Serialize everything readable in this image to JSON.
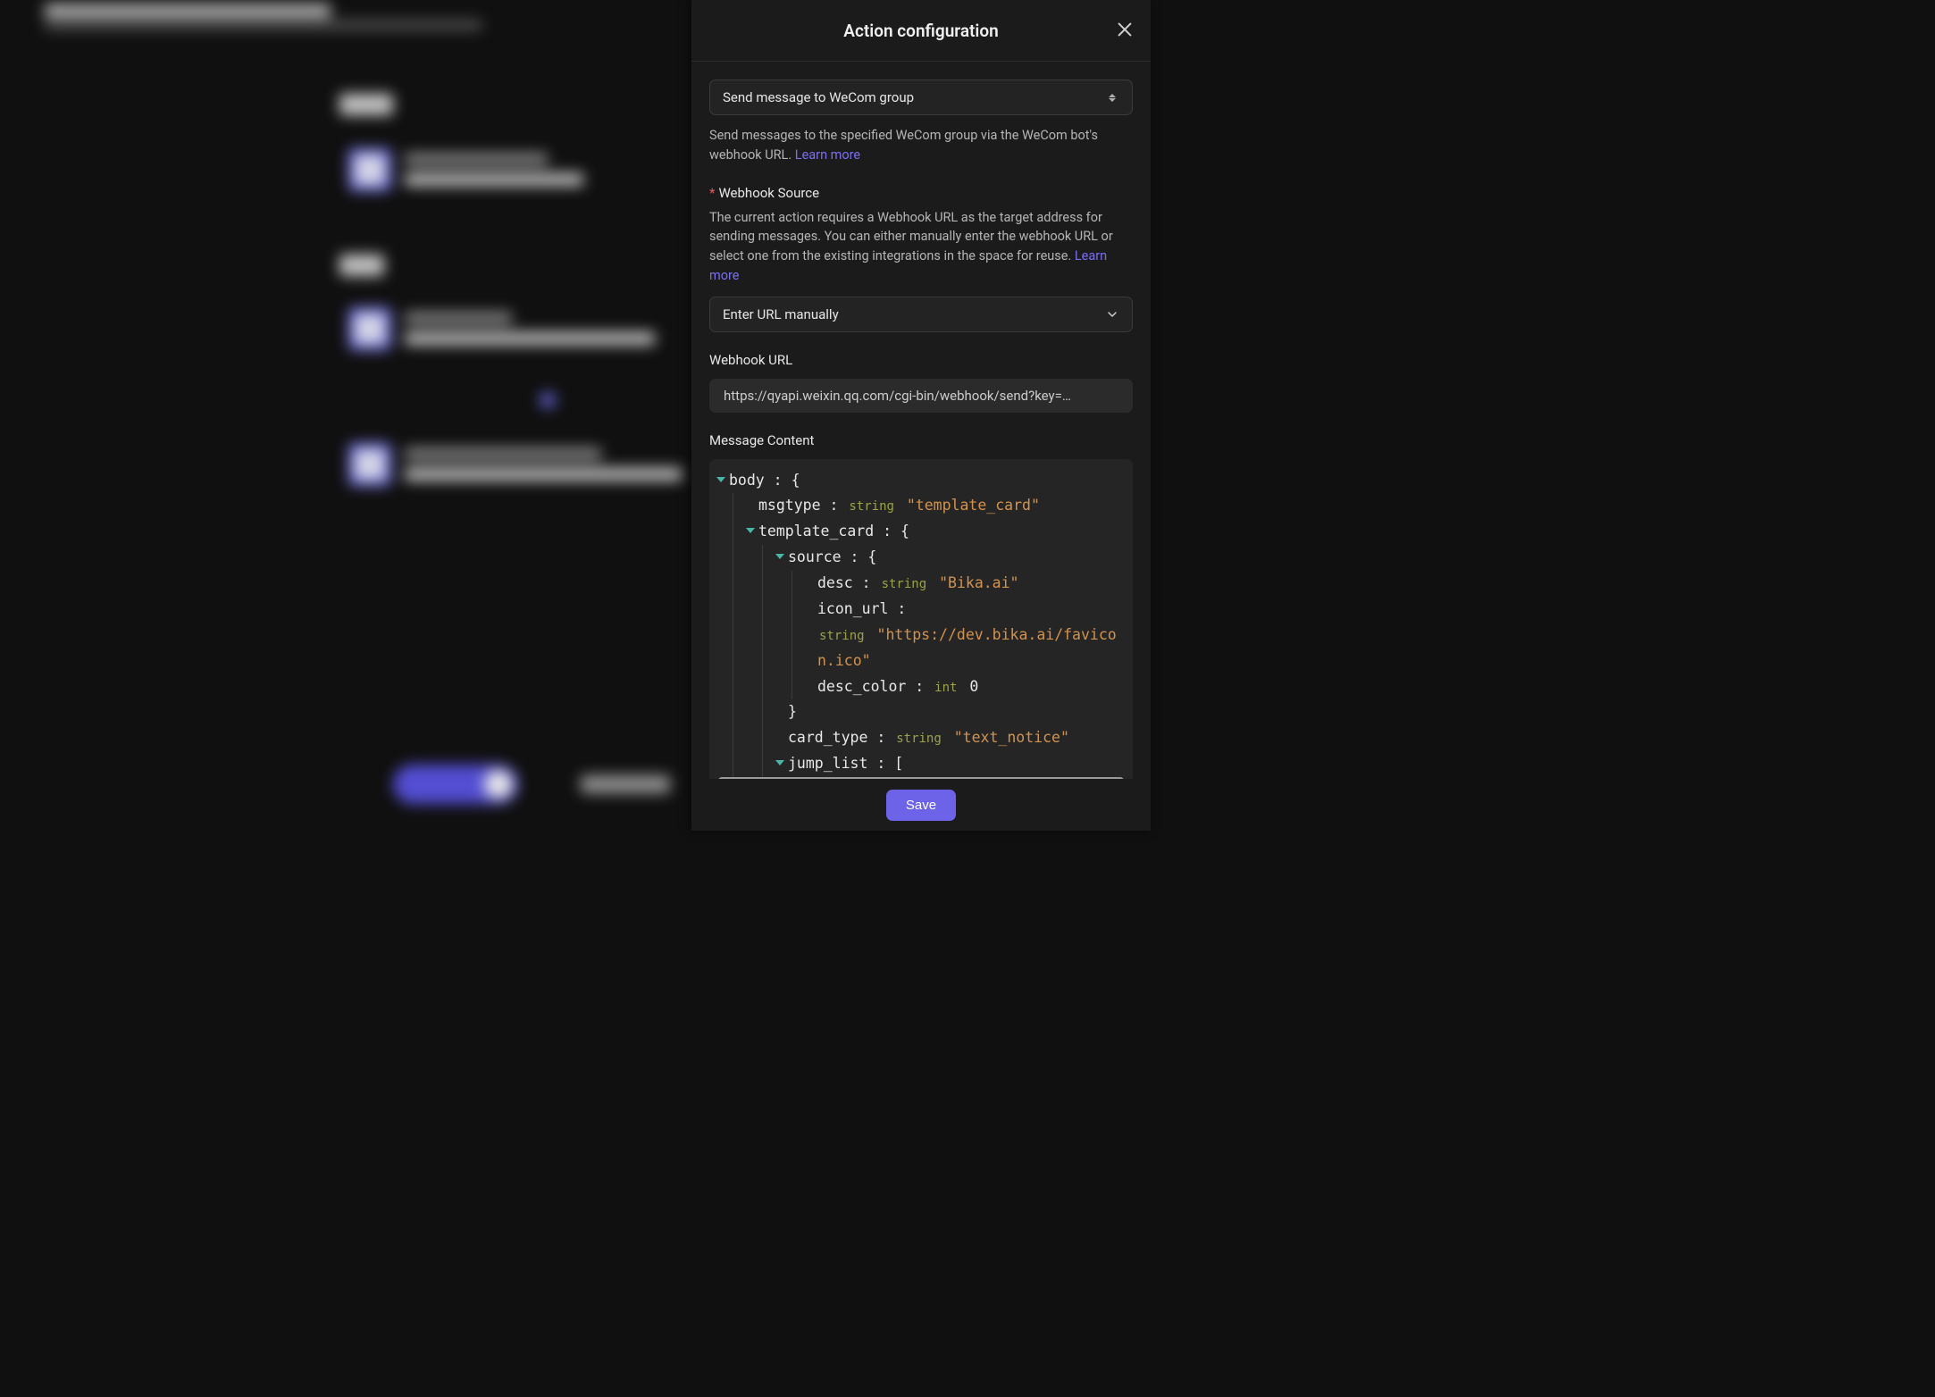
{
  "panel": {
    "title": "Action configuration",
    "action_select": "Send message to WeCom group",
    "action_desc": "Send messages to the specified WeCom group via the WeCom bot's webhook URL. ",
    "learn_more": "Learn more",
    "webhook_source_label": "Webhook Source",
    "webhook_source_desc": "The current action requires a Webhook URL as the target address for sending messages. You can either manually enter the webhook URL or select one from the existing integrations in the space for reuse. ",
    "webhook_source_select": "Enter URL manually",
    "webhook_url_label": "Webhook URL",
    "webhook_url_value": "https://qyapi.weixin.qq.com/cgi-bin/webhook/send?key=…",
    "message_content_label": "Message Content",
    "save": "Save"
  },
  "json": {
    "body": "body",
    "msgtype_key": "msgtype",
    "msgtype_val": "\"template_card\"",
    "template_card": "template_card",
    "source": "source",
    "desc_key": "desc",
    "desc_val": "\"Bika.ai\"",
    "icon_url_key": "icon_url",
    "icon_url_val": "\"https://dev.bika.ai/favicon.ico\"",
    "desc_color_key": "desc_color",
    "desc_color_val": "0",
    "card_type_key": "card_type",
    "card_type_val": "\"text_notice\"",
    "jump_list": "jump_list",
    "t_string": "string",
    "t_int": "int",
    "colon": " : ",
    "brace_open": "{",
    "brace_close": "}",
    "bracket_open": "["
  }
}
